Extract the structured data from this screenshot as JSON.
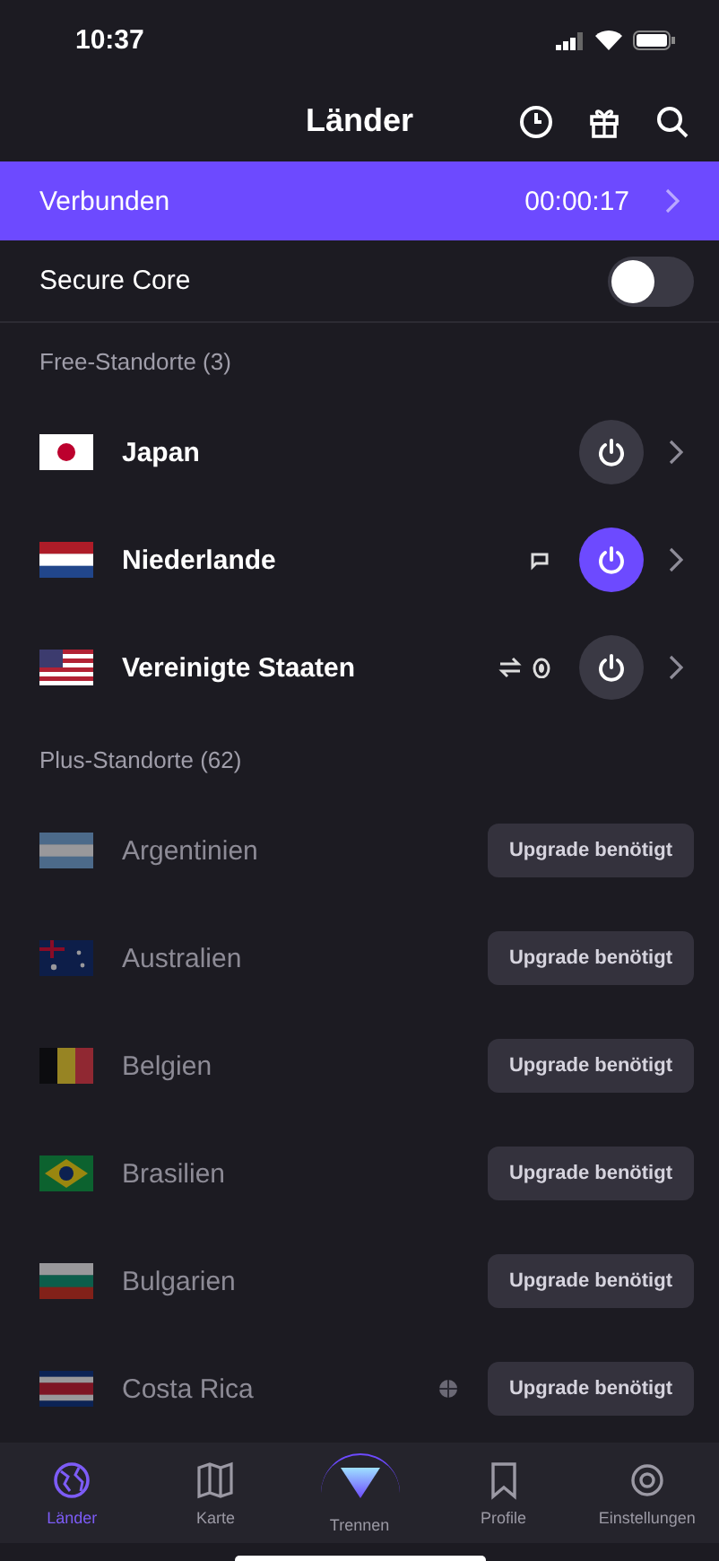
{
  "status_bar": {
    "time": "10:37"
  },
  "header": {
    "title": "Länder"
  },
  "connection_banner": {
    "label": "Verbunden",
    "timer": "00:00:17",
    "connected": true
  },
  "secure_core": {
    "label": "Secure Core",
    "on": false
  },
  "sections": [
    {
      "title": "Free-Standorte (3)",
      "countries": [
        {
          "name": "Japan",
          "kind": "free",
          "connected": false
        },
        {
          "name": "Niederlande",
          "kind": "free",
          "connected": true
        },
        {
          "name": "Vereinigte Staaten",
          "kind": "free",
          "connected": false
        }
      ]
    },
    {
      "title": "Plus-Standorte (62)",
      "countries": [
        {
          "name": "Argentinien",
          "kind": "plus",
          "action": "Upgrade benötigt"
        },
        {
          "name": "Australien",
          "kind": "plus",
          "action": "Upgrade benötigt"
        },
        {
          "name": "Belgien",
          "kind": "plus",
          "action": "Upgrade benötigt"
        },
        {
          "name": "Brasilien",
          "kind": "plus",
          "action": "Upgrade benötigt"
        },
        {
          "name": "Bulgarien",
          "kind": "plus",
          "action": "Upgrade benötigt"
        },
        {
          "name": "Costa Rica",
          "kind": "plus",
          "action": "Upgrade benötigt"
        }
      ]
    }
  ],
  "tab_bar": [
    {
      "label": "Länder",
      "kind": "normal",
      "selected": true
    },
    {
      "label": "Karte",
      "kind": "normal",
      "selected": false
    },
    {
      "label": "Trennen",
      "kind": "center",
      "selected": false
    },
    {
      "label": "Profile",
      "kind": "normal",
      "selected": false
    },
    {
      "label": "Einstellungen",
      "kind": "normal",
      "selected": false
    }
  ]
}
